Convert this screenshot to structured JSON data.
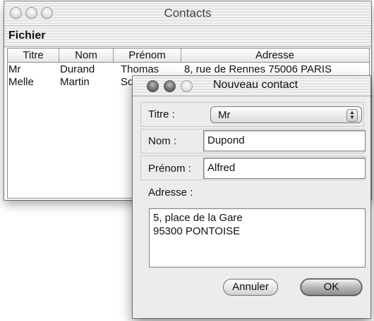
{
  "main_window": {
    "title": "Contacts",
    "menu": {
      "fichier": "Fichier"
    },
    "table": {
      "headers": [
        "Titre",
        "Nom",
        "Prénom",
        "Adresse"
      ],
      "rows": [
        [
          "Mr",
          "Durand",
          "Thomas",
          "8, rue de Rennes 75006 PARIS"
        ],
        [
          "Melle",
          "Martin",
          "Sop",
          ""
        ]
      ]
    }
  },
  "dialog": {
    "title": "Nouveau contact",
    "titre_label": "Titre :",
    "titre_value": "Mr",
    "nom_label": "Nom :",
    "nom_value": "Dupond",
    "prenom_label": "Prénom :",
    "prenom_value": "Alfred",
    "adresse_label": "Adresse :",
    "adresse_value": "5, place de la Gare\n95300 PONTOISE",
    "cancel_label": "Annuler",
    "ok_label": "OK"
  },
  "icons": {
    "close": "close-icon",
    "minimize": "minimize-icon",
    "zoom": "zoom-icon",
    "popup_arrows": "updown-arrows-icon"
  }
}
